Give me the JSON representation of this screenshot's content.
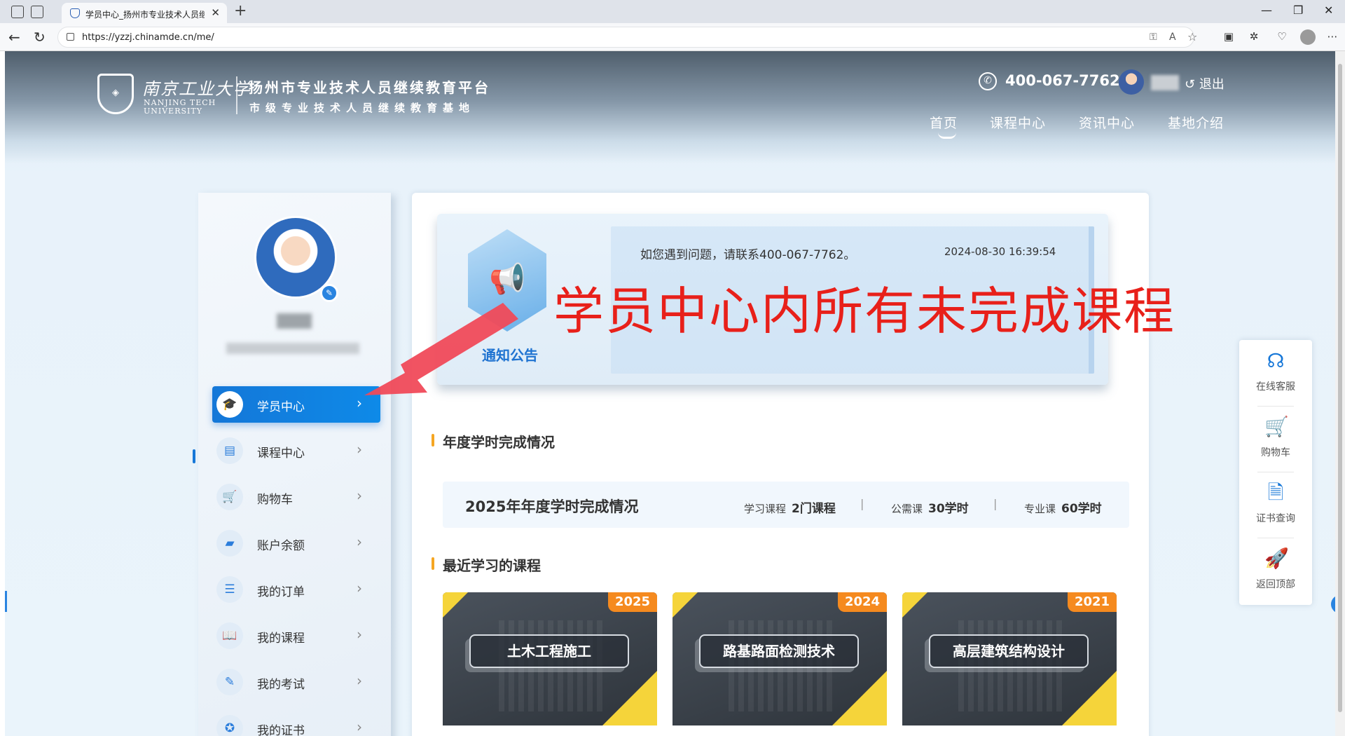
{
  "browser": {
    "tab_title": "学员中心_扬州市专业技术人员继续教育平台",
    "url": "https://yzzj.chinamde.cn/me/",
    "new_tab": "+",
    "tab_close": "✕",
    "minimize": "—",
    "maximize": "❐",
    "close": "✕"
  },
  "header": {
    "logo_cn": "南京工业大学",
    "logo_en_1": "NANJING TECH",
    "logo_en_2": "UNIVERSITY",
    "platform_title": "扬州市专业技术人员继续教育平台",
    "platform_subtitle": "市级专业技术人员继续教育基地",
    "phone": "400-067-7762",
    "logout": "退出",
    "nav": [
      {
        "label": "首页",
        "active": true
      },
      {
        "label": "课程中心"
      },
      {
        "label": "资讯中心"
      },
      {
        "label": "基地介绍"
      }
    ]
  },
  "sidebar": {
    "menu": [
      {
        "label": "学员中心",
        "icon": "graduation-cap-icon",
        "active": true
      },
      {
        "label": "课程中心",
        "icon": "book-icon"
      },
      {
        "label": "购物车",
        "icon": "cart-icon"
      },
      {
        "label": "账户余额",
        "icon": "wallet-icon"
      },
      {
        "label": "我的订单",
        "icon": "order-icon"
      },
      {
        "label": "我的课程",
        "icon": "open-book-icon"
      },
      {
        "label": "我的考试",
        "icon": "exam-icon"
      },
      {
        "label": "我的证书",
        "icon": "certificate-icon"
      }
    ]
  },
  "notice": {
    "title": "通知公告",
    "text": "如您遇到问题，请联系400-067-7762。",
    "time": "2024-08-30 16:39:54"
  },
  "annual": {
    "section_title": "年度学时完成情况",
    "title": "2025年年度学时完成情况",
    "items": [
      {
        "label": "学习课程",
        "value": "2门课程"
      },
      {
        "label": "公需课",
        "value": "30学时"
      },
      {
        "label": "专业课",
        "value": "60学时"
      }
    ],
    "separator": "|"
  },
  "recent": {
    "section_title": "最近学习的课程",
    "courses": [
      {
        "name": "土木工程施工",
        "year": "2025"
      },
      {
        "name": "路基路面检测技术",
        "year": "2024"
      },
      {
        "name": "高层建筑结构设计",
        "year": "2021"
      }
    ]
  },
  "float_bar": [
    {
      "label": "在线客服",
      "icon": "headset-icon"
    },
    {
      "label": "购物车",
      "icon": "cart-icon"
    },
    {
      "label": "证书查询",
      "icon": "certificate-search-icon"
    },
    {
      "label": "返回顶部",
      "icon": "rocket-icon"
    }
  ],
  "annotation": {
    "text": "学员中心内所有未完成课程",
    "color": "#e8201a"
  },
  "colors": {
    "accent": "#1677d8",
    "year_badge": "#f58a1f",
    "course_stripe": "#f5d43a"
  }
}
